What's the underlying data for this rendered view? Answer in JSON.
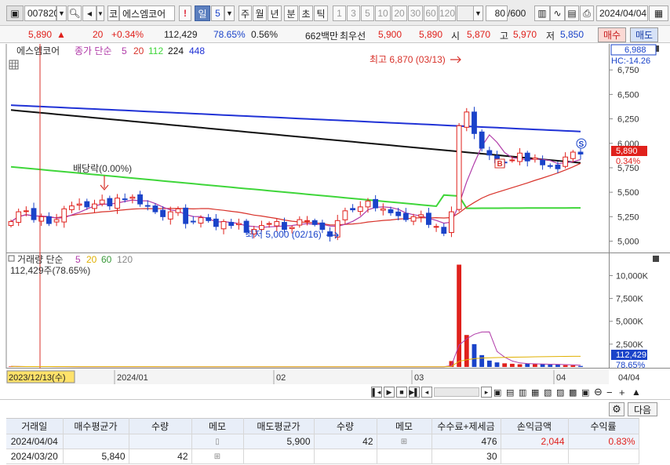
{
  "toolbar": {
    "stock_code": "007820",
    "market_tag": "코",
    "stock_name": "에스엠코어",
    "exclaim": "!",
    "period_sel": "일",
    "period_num": "5",
    "periods": [
      "주",
      "월",
      "년",
      "분",
      "초",
      "틱"
    ],
    "minute_nums": [
      "1",
      "3",
      "5",
      "10",
      "20",
      "30",
      "60",
      "120"
    ],
    "count_value": "80",
    "count_total": "/600",
    "date_value": "2024/04/04"
  },
  "quote": {
    "price": "5,890",
    "change": "20",
    "change_pct": "+0.34%",
    "volume": "112,429",
    "vol_ratio": "78.65%",
    "turnover": "0.56%",
    "amount": "662백만",
    "best_label": "최우선",
    "ask": "5,900",
    "bid": "5,890",
    "open_label": "시",
    "open": "5,870",
    "high_label": "고",
    "high": "5,970",
    "low_label": "저",
    "low": "5,850",
    "buy_label": "매수",
    "sell_label": "매도"
  },
  "price_panel": {
    "legend_name": "에스엠코어",
    "legend_ma_prefix": "종가 단순",
    "ma5": "5",
    "ma20": "20",
    "ma112": "112",
    "ma224": "224",
    "ma448": "448",
    "ticks": [
      "6,750",
      "6,500",
      "6,250",
      "6,000",
      "5,750",
      "5,500",
      "5,250",
      "5,000"
    ],
    "top_box": "6,988",
    "hc_label": "HC:-14.26",
    "last_price_box": "5,890",
    "last_pct": "0.34%",
    "high_note": "최고 6,870 (03/13)",
    "low_note": "최저 5,000 (02/16)",
    "dividend_note": "배당락(0.00%)",
    "marker_s": "S",
    "marker_b": "B"
  },
  "volume_panel": {
    "legend": "거래량 단순",
    "ma5": "5",
    "ma20": "20",
    "ma60": "60",
    "ma120": "120",
    "current": "112,429주(78.65%)",
    "ticks": [
      "10,000K",
      "7,500K",
      "5,000K",
      "2,500K"
    ],
    "last_box": "112,429",
    "last_pct": "78.65%"
  },
  "xaxis": {
    "cursor_date": "2023/12/13(수)",
    "labels": [
      "2024/01",
      "02",
      "03",
      "04",
      "04/04"
    ]
  },
  "colors": {
    "up": "#e0211c",
    "down": "#1a43c9",
    "ma5": "#b03aa8",
    "ma20": "#d8322a",
    "ma112": "#3fd63a",
    "ma224": "#111111",
    "ma448": "#2032d6"
  },
  "table": {
    "next_label": "다음",
    "headers": [
      "거래일",
      "매수평균가",
      "수량",
      "메모",
      "매도평균가",
      "수량",
      "메모",
      "수수료+제세금",
      "손익금액",
      "수익률"
    ],
    "rows": [
      [
        "2024/04/04",
        "",
        "",
        "",
        "5,900",
        "42",
        "",
        "476",
        "2,044",
        "0.83%"
      ],
      [
        "2024/03/20",
        "5,840",
        "42",
        "",
        "",
        "",
        "",
        "30",
        "",
        ""
      ]
    ]
  },
  "chart_data": {
    "type": "candlestick",
    "title": "에스엠코어",
    "x": [
      "2023-12-13",
      "2023-12-14",
      "2023-12-15",
      "2023-12-18",
      "2023-12-19",
      "2023-12-20",
      "2023-12-21",
      "2023-12-22",
      "2023-12-26",
      "2023-12-27",
      "2023-12-28",
      "2024-01-02",
      "2024-01-03",
      "2024-01-04",
      "2024-01-05",
      "2024-01-08",
      "2024-01-09",
      "2024-01-10",
      "2024-01-11",
      "2024-01-12",
      "2024-01-15",
      "2024-01-16",
      "2024-01-17",
      "2024-01-18",
      "2024-01-19",
      "2024-01-22",
      "2024-01-23",
      "2024-01-24",
      "2024-01-25",
      "2024-01-26",
      "2024-01-29",
      "2024-01-30",
      "2024-01-31",
      "2024-02-01",
      "2024-02-02",
      "2024-02-05",
      "2024-02-06",
      "2024-02-07",
      "2024-02-08",
      "2024-02-13",
      "2024-02-14",
      "2024-02-15",
      "2024-02-16",
      "2024-02-19",
      "2024-02-20",
      "2024-02-21",
      "2024-02-22",
      "2024-02-23",
      "2024-02-26",
      "2024-02-27",
      "2024-02-28",
      "2024-02-29",
      "2024-03-04",
      "2024-03-05",
      "2024-03-06",
      "2024-03-07",
      "2024-03-08",
      "2024-03-11",
      "2024-03-12",
      "2024-03-13",
      "2024-03-14",
      "2024-03-15",
      "2024-03-18",
      "2024-03-19",
      "2024-03-20",
      "2024-03-21",
      "2024-03-22",
      "2024-03-25",
      "2024-03-26",
      "2024-03-27",
      "2024-03-28",
      "2024-03-29",
      "2024-04-01",
      "2024-04-02",
      "2024-04-03",
      "2024-04-04"
    ],
    "close": [
      5200,
      5300,
      5310,
      5220,
      5250,
      5180,
      5220,
      5330,
      5360,
      5380,
      5350,
      5380,
      5420,
      5360,
      5440,
      5430,
      5450,
      5380,
      5360,
      5300,
      5250,
      5300,
      5330,
      5180,
      5200,
      5240,
      5210,
      5150,
      5200,
      5160,
      5180,
      5090,
      5120,
      5160,
      5180,
      5200,
      5120,
      5140,
      5220,
      5210,
      5170,
      5120,
      5050,
      5210,
      5310,
      5320,
      5350,
      5410,
      5340,
      5330,
      5290,
      5260,
      5220,
      5250,
      5270,
      5170,
      5150,
      5080,
      5300,
      6180,
      6320,
      6100,
      5950,
      5880,
      5800,
      5800,
      5830,
      5900,
      5820,
      5850,
      5780,
      5770,
      5740,
      5860,
      5910,
      5890
    ],
    "volume_K": [
      60,
      40,
      35,
      30,
      55,
      40,
      30,
      20,
      25,
      20,
      30,
      35,
      25,
      20,
      30,
      25,
      20,
      20,
      25,
      30,
      20,
      25,
      20,
      30,
      25,
      20,
      20,
      25,
      20,
      25,
      30,
      20,
      20,
      25,
      20,
      30,
      20,
      25,
      30,
      25,
      20,
      25,
      40,
      30,
      25,
      20,
      25,
      30,
      20,
      20,
      25,
      20,
      30,
      25,
      20,
      25,
      30,
      35,
      650,
      11200,
      3500,
      2500,
      1300,
      700,
      500,
      400,
      350,
      300,
      350,
      300,
      300,
      250,
      250,
      200,
      180,
      112
    ],
    "ylim": [
      4900,
      7000
    ],
    "series": [
      {
        "name": "5",
        "color": "#b03aa8"
      },
      {
        "name": "20",
        "color": "#d8322a"
      },
      {
        "name": "112",
        "color": "#3fd63a",
        "start": 5760,
        "end": 5380
      },
      {
        "name": "224",
        "color": "#111111",
        "start": 6340,
        "end": 5800
      },
      {
        "name": "448",
        "color": "#2032d6",
        "start": 6390,
        "end": 6120
      }
    ]
  }
}
